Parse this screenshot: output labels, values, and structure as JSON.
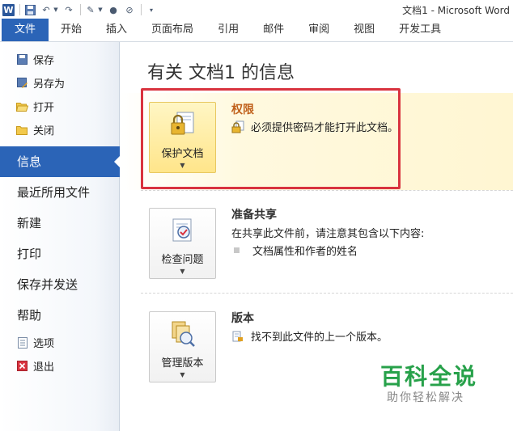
{
  "qat": {
    "app_icon": "W",
    "window_title": "文档1 - Microsoft Word",
    "icons": [
      "save-icon",
      "undo-icon",
      "redo-icon",
      "format-painter-icon",
      "record-icon",
      "eraser-icon",
      "customize-icon"
    ]
  },
  "tabs": [
    "文件",
    "开始",
    "插入",
    "页面布局",
    "引用",
    "邮件",
    "审阅",
    "视图",
    "开发工具"
  ],
  "nav": {
    "save": "保存",
    "save_as": "另存为",
    "open": "打开",
    "close": "关闭",
    "info": "信息",
    "recent": "最近所用文件",
    "new": "新建",
    "print": "打印",
    "save_send": "保存并发送",
    "help": "帮助",
    "options": "选项",
    "exit": "退出"
  },
  "main": {
    "title": "有关 文档1 的信息",
    "permissions": {
      "button_label": "保护文档",
      "title": "权限",
      "line": "必须提供密码才能打开此文档。"
    },
    "prepare": {
      "button_label": "检查问题",
      "title": "准备共享",
      "line": "在共享此文件前，请注意其包含以下内容:",
      "bullet": "文档属性和作者的姓名"
    },
    "versions": {
      "button_label": "管理版本",
      "title": "版本",
      "line": "找不到此文件的上一个版本。"
    }
  },
  "watermark": {
    "title": "百科全说",
    "subtitle": "助你轻松解决"
  },
  "colors": {
    "accent": "#2b64b7",
    "highlight_box": "#d9333f",
    "permission_title": "#c0601a"
  }
}
